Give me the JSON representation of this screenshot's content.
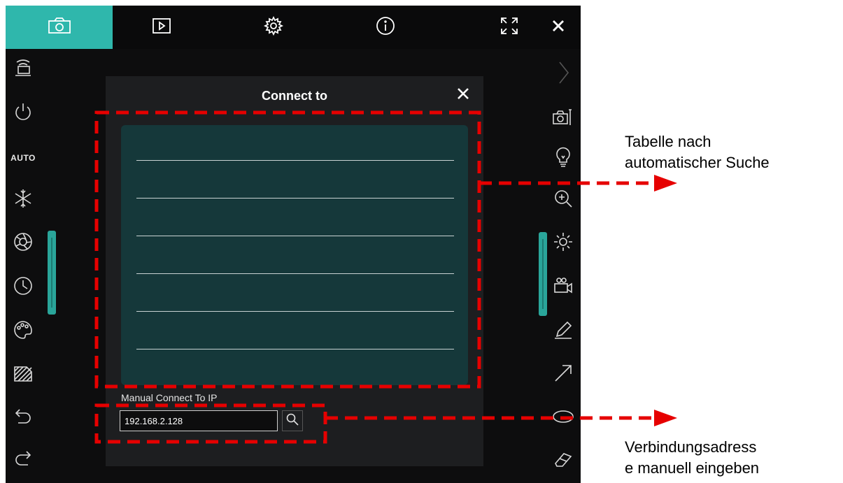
{
  "dialog": {
    "title": "Connect to",
    "manual_label": "Manual Connect To IP",
    "ip_value": "192.168.2.128"
  },
  "left_toolbar": {
    "auto_label": "AUTO"
  },
  "annotations": {
    "table_note_line1": "Tabelle nach",
    "table_note_line2": "automatischer Suche",
    "manual_note_line1": "Verbindungsadress",
    "manual_note_line2": "e manuell eingeben"
  },
  "colors": {
    "accent": "#2fb7ac",
    "table_bg": "#15383a",
    "dashed_annotation": "#e60000"
  },
  "icons": {
    "top": [
      "camera-icon",
      "playback-icon",
      "settings-icon",
      "info-icon",
      "fullscreen-icon",
      "close-icon"
    ],
    "left": [
      "network-camera-icon",
      "power-icon",
      "auto-label",
      "freeze-icon",
      "aperture-icon",
      "timer-icon",
      "palette-icon",
      "hatch-icon",
      "undo-icon",
      "redo-icon"
    ],
    "right": [
      "collapse-chevron-icon",
      "camera-settings-icon",
      "lamp-icon",
      "zoom-in-icon",
      "brightness-icon",
      "record-icon",
      "pen-icon",
      "arrow-icon",
      "ellipse-icon",
      "eraser-icon"
    ]
  }
}
